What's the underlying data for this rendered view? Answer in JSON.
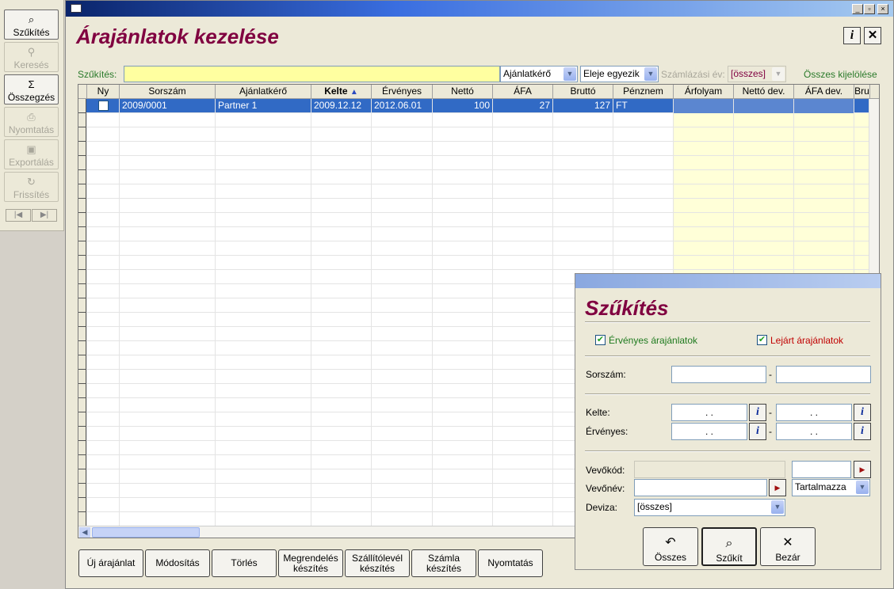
{
  "toolbar": {
    "buttons": [
      {
        "label": "Szűkítés",
        "icon": "binoculars-filter-icon",
        "active": true
      },
      {
        "label": "Keresés",
        "icon": "binoculars-icon",
        "active": false
      },
      {
        "label": "Összegzés",
        "icon": "sigma-icon",
        "active": true
      },
      {
        "label": "Nyomtatás",
        "icon": "printer-icon",
        "active": false
      },
      {
        "label": "Exportálás",
        "icon": "floppy-disk-icon",
        "active": false
      },
      {
        "label": "Frissítés",
        "icon": "refresh-icon",
        "active": false
      }
    ],
    "nav_prev": "|◀",
    "nav_next": "▶|"
  },
  "window": {
    "title": "Árajánlatok kezelése",
    "info_button": "i",
    "close_button": "✕",
    "min_glyph": "_",
    "max_glyph": "▫",
    "x_glyph": "×"
  },
  "filter_bar": {
    "label": "Szűkítés:",
    "input_value": "",
    "field_combo": "Ajánlatkérő",
    "mode_combo": "Eleje egyezik",
    "year_label": "Számlázási év:",
    "year_combo": "[összes]",
    "select_all": "Összes kijelölése"
  },
  "grid": {
    "columns": [
      "Ny",
      "Sorszám",
      "Ajánlatkérő",
      "Kelte",
      "Érvényes",
      "Nettó",
      "ÁFA",
      "Bruttó",
      "Pénznem",
      "Árfolyam",
      "Nettó dev.",
      "ÁFA dev.",
      "Bru"
    ],
    "sort_column": "Kelte",
    "rows": [
      {
        "sorszam": "2009/0001",
        "ajanlatkero": "Partner 1",
        "kelte": "2009.12.12",
        "ervenyes": "2012.06.01",
        "netto": "100",
        "afa": "27",
        "brutto": "127",
        "penznem": "FT"
      }
    ]
  },
  "dialog": {
    "title": "Szűkítés",
    "valid_checkbox": "Érvényes árajánlatok",
    "expired_checkbox": "Lejárt árajánlatok",
    "sorszam_label": "Sorszám:",
    "kelte_label": "Kelte:",
    "ervenyes_label": "Érvényes:",
    "date_placeholder": ". .",
    "dash": "-",
    "vevokod_label": "Vevőkód:",
    "vevonev_label": "Vevőnév:",
    "deviza_label": "Deviza:",
    "match_combo": "Tartalmazza",
    "deviza_combo": "[összes]",
    "buttons": {
      "all": "Összes",
      "filter": "Szűkít",
      "close": "Bezár"
    },
    "colors": {
      "valid": "#1e7a1e",
      "expired": "#c00000"
    }
  },
  "actions": [
    {
      "label": "Új árajánlat"
    },
    {
      "label": "Módosítás"
    },
    {
      "label": "Törlés"
    },
    {
      "label": "Megrendelés készítés"
    },
    {
      "label": "Szállítólevél készítés"
    },
    {
      "label": "Számla készítés"
    },
    {
      "label": "Nyomtatás"
    }
  ]
}
